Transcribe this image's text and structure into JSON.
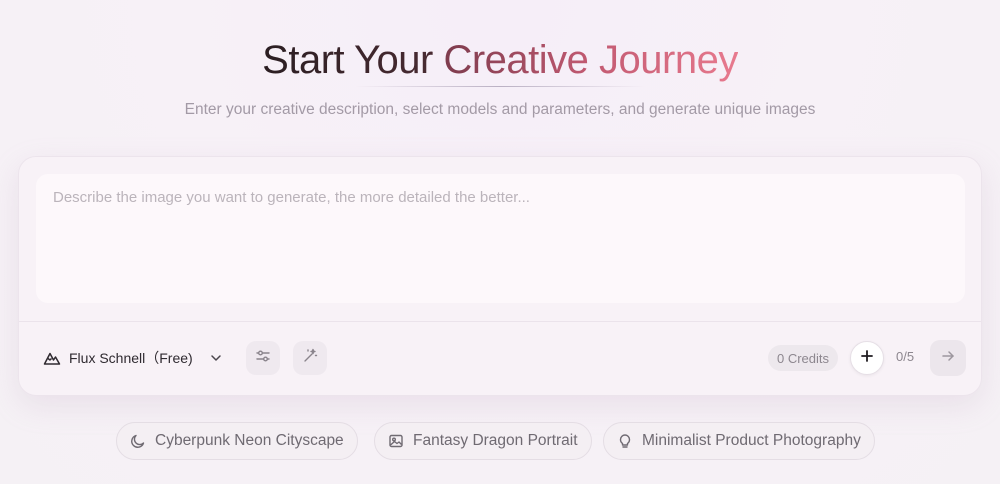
{
  "hero": {
    "title_part1": "Start Your ",
    "title_part2": "Creative Journey",
    "subtitle": "Enter your creative description, select models and parameters, and generate unique images"
  },
  "prompt": {
    "value": "",
    "placeholder": "Describe the image you want to generate, the more detailed the better..."
  },
  "toolbar": {
    "model_label": "Flux Schnell（Free)",
    "model_icon": "mountain-icon",
    "settings_icon": "sliders-icon",
    "enhance_icon": "magic-wand-icon",
    "credits_label": "0 Credits",
    "add_icon": "plus-icon",
    "counter": "0/5",
    "send_icon": "arrow-right-icon"
  },
  "suggestions": [
    {
      "label": "Cyberpunk Neon Cityscape",
      "icon": "moon-icon"
    },
    {
      "label": "Fantasy Dragon Portrait",
      "icon": "image-icon"
    },
    {
      "label": "Minimalist Product Photography",
      "icon": "lightbulb-icon"
    }
  ],
  "colors": {
    "title_gradient_end": "#e87a8e",
    "title_dark": "#2b1e22",
    "card_bg": "#f8f2f7"
  }
}
